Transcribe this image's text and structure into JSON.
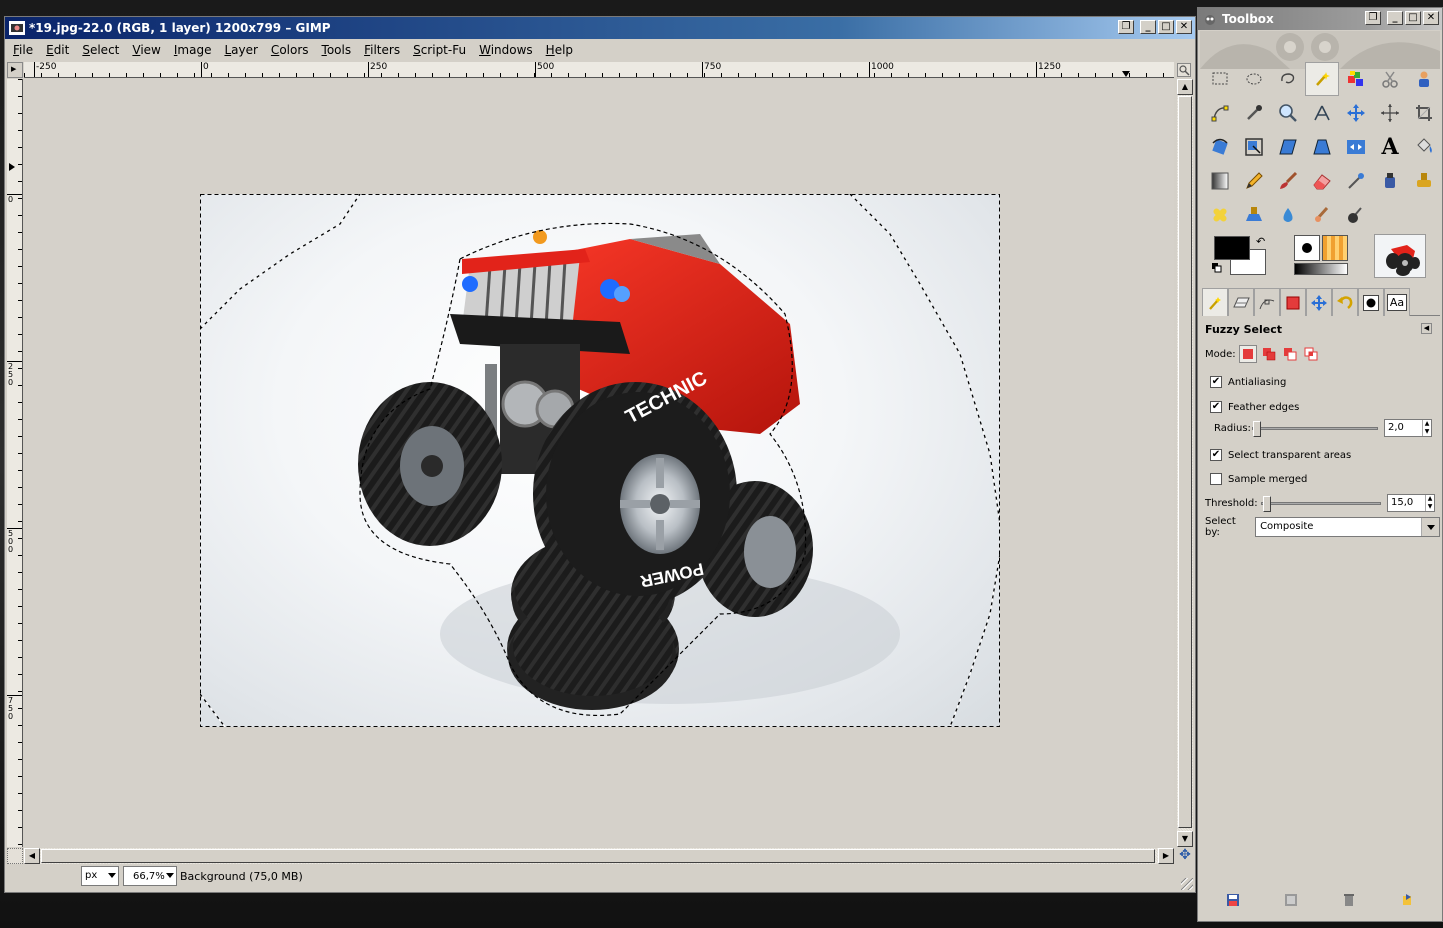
{
  "image_window": {
    "title": "*19.jpg-22.0 (RGB, 1 layer) 1200x799 – GIMP",
    "menus": [
      "File",
      "Edit",
      "Select",
      "View",
      "Image",
      "Layer",
      "Colors",
      "Tools",
      "Filters",
      "Script-Fu",
      "Windows",
      "Help"
    ],
    "ruler_h_labels": [
      "-250",
      "0",
      "250",
      "500",
      "750",
      "1000",
      "1250"
    ],
    "ruler_v_labels": [
      "0",
      "250",
      "500",
      "750"
    ],
    "status": {
      "unit": "px",
      "zoom": "66,7%",
      "layer_info": "Background (75,0 MB)"
    }
  },
  "toolbox": {
    "title": "Toolbox",
    "tools": [
      "rect-select-icon",
      "ellipse-select-icon",
      "free-select-icon",
      "fuzzy-select-icon",
      "select-by-color-icon",
      "scissors-icon",
      "foreground-select-icon",
      "paths-icon",
      "color-picker-icon",
      "zoom-icon",
      "measure-icon",
      "move-icon",
      "align-icon",
      "crop-icon",
      "rotate-icon",
      "scale-icon",
      "shear-icon",
      "perspective-icon",
      "flip-icon",
      "text-icon",
      "bucket-fill-icon",
      "blend-icon",
      "pencil-icon",
      "paintbrush-icon",
      "eraser-icon",
      "airbrush-icon",
      "ink-icon",
      "clone-icon",
      "heal-icon",
      "perspective-clone-icon",
      "blur-icon",
      "smudge-icon",
      "dodge-burn-icon"
    ],
    "active_tool_index": 3,
    "fg_color": "#000000",
    "bg_color": "#ffffff",
    "tool_options": {
      "title": "Fuzzy Select",
      "mode_label": "Mode:",
      "antialiasing": {
        "label": "Antialiasing",
        "checked": true
      },
      "feather_edges": {
        "label": "Feather edges",
        "checked": true
      },
      "radius": {
        "label": "Radius:",
        "value": "2,0"
      },
      "select_transparent": {
        "label": "Select transparent areas",
        "checked": true
      },
      "sample_merged": {
        "label": "Sample merged",
        "checked": false
      },
      "threshold": {
        "label": "Threshold:",
        "value": "15,0"
      },
      "select_by": {
        "label": "Select by:",
        "value": "Composite"
      }
    }
  },
  "text_glyphs": {
    "check": "✔",
    "close": "✕",
    "minimize": "_",
    "maximize": "□",
    "restore": "❐",
    "arrow_up": "▲",
    "arrow_down": "▼",
    "arrow_left": "◀",
    "arrow_right": "▶",
    "panel_menu": "◀",
    "text_tool": "A",
    "font_tab": "Aa",
    "swap": "↶",
    "nav": "✥"
  }
}
